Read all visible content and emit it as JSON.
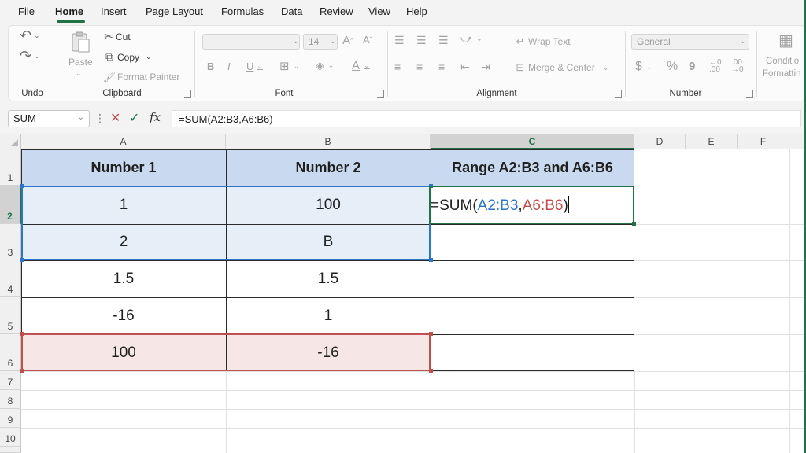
{
  "menu": {
    "tabs": [
      "File",
      "Home",
      "Insert",
      "Page Layout",
      "Formulas",
      "Data",
      "Review",
      "View",
      "Help"
    ],
    "active": "Home"
  },
  "ribbon": {
    "undo": {
      "label": "Undo"
    },
    "clipboard": {
      "label": "Clipboard",
      "paste": "Paste",
      "cut": "Cut",
      "copy": "Copy",
      "format_painter": "Format Painter"
    },
    "font": {
      "label": "Font",
      "font_name": "",
      "font_size": "14"
    },
    "alignment": {
      "label": "Alignment",
      "wrap_text": "Wrap Text",
      "merge_center": "Merge & Center"
    },
    "number": {
      "label": "Number",
      "format": "General"
    },
    "styles": {
      "conditional_line1": "Conditio",
      "conditional_line2": "Formattin"
    }
  },
  "formula_bar": {
    "name_box": "SUM",
    "fx": "fx",
    "formula": "=SUM(A2:B3,A6:B6)"
  },
  "columns": [
    "A",
    "B",
    "C",
    "D",
    "E",
    "F"
  ],
  "rows": [
    "1",
    "2",
    "3",
    "4",
    "5",
    "6",
    "7",
    "8",
    "9",
    "10"
  ],
  "table": {
    "headers": [
      "Number 1",
      "Number 2",
      "Range A2:B3 and A6:B6"
    ],
    "rows": [
      [
        "1",
        "100"
      ],
      [
        "2",
        "B"
      ],
      [
        "1.5",
        "1.5"
      ],
      [
        "-16",
        "1"
      ],
      [
        "100",
        "-16"
      ]
    ]
  },
  "editing_cell": {
    "prefix": "=SUM(",
    "ref1": "A2:B3",
    "comma": ",",
    "ref2": "A6:B6",
    "suffix": ")"
  },
  "colors": {
    "accent": "#217346",
    "header_fill": "#c9daf0",
    "range1": "#2e75c7",
    "range2": "#c0504d"
  }
}
